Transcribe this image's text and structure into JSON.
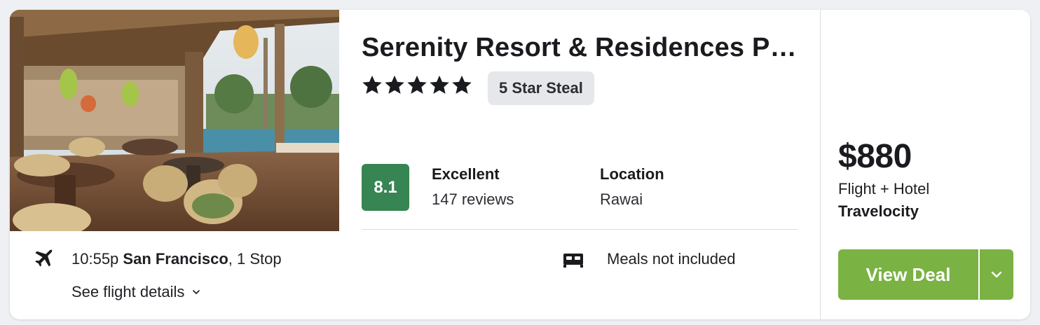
{
  "hotel": {
    "name": "Serenity Resort & Residences Phuket",
    "star_rating": 5,
    "badge": "5 Star Steal",
    "image_alt": "Resort terrace with rattan chairs and pool"
  },
  "rating": {
    "score": "8.1",
    "label": "Excellent",
    "reviews": "147 reviews"
  },
  "location": {
    "label": "Location",
    "value": "Rawai"
  },
  "flight": {
    "time": "10:55p",
    "origin": "San Francisco",
    "stops": ", 1 Stop",
    "details_link": "See flight details"
  },
  "amenity": {
    "meals": "Meals not included"
  },
  "deal": {
    "price": "$880",
    "bundle": "Flight + Hotel",
    "provider": "Travelocity",
    "button_label": "View Deal"
  },
  "colors": {
    "rating_green": "#368552",
    "deal_green": "#7ab244",
    "badge_grey": "#e5e7ea"
  }
}
